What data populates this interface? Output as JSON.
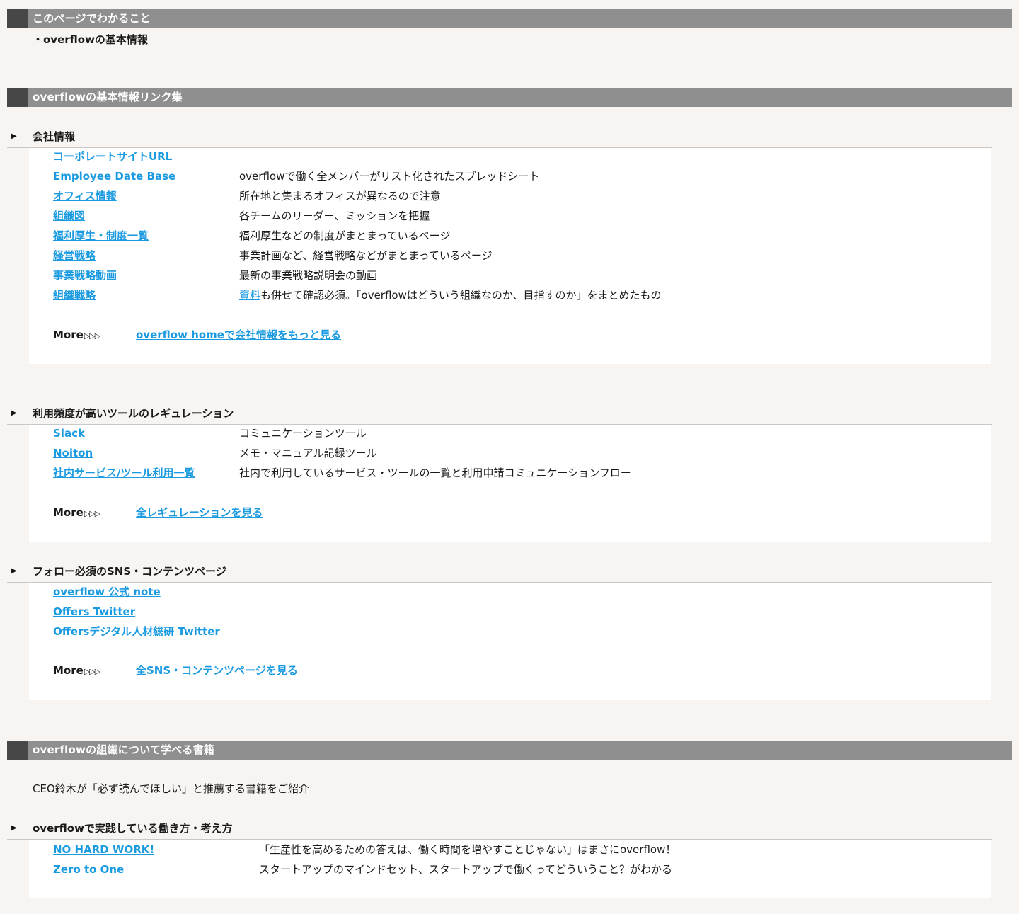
{
  "overview": {
    "header": "このページでわかること",
    "bullet": "・overflowの基本情報"
  },
  "links_section": {
    "header": "overflowの基本情報リンク集",
    "more_label": "More",
    "more_arrows": "▷▷▷",
    "company": {
      "heading": "会社情報",
      "rows": [
        {
          "link": "コーポレートサイトURL",
          "desc": ""
        },
        {
          "link": "Employee Date Base",
          "desc": "overflowで働く全メンバーがリスト化されたスプレッドシート"
        },
        {
          "link": "オフィス情報",
          "desc": "所在地と集まるオフィスが異なるので注意"
        },
        {
          "link": "組織図",
          "desc": "各チームのリーダー、ミッションを把握"
        },
        {
          "link": "福利厚生・制度一覧",
          "desc": "福利厚生などの制度がまとまっているページ"
        },
        {
          "link": "経営戦略",
          "desc": "事業計画など、経営戦略などがまとまっているページ"
        },
        {
          "link": "事業戦略動画",
          "desc": "最新の事業戦略説明会の動画"
        },
        {
          "link": "組織戦略",
          "desc_link": "資料",
          "desc": "も併せて確認必須。「overflowはどういう組織なのか、目指すのか」をまとめたもの"
        }
      ],
      "more_link": "overflow homeで会社情報をもっと見る"
    },
    "tools": {
      "heading": "利用頻度が高いツールのレギュレーション",
      "rows": [
        {
          "link": "Slack",
          "desc": "コミュニケーションツール"
        },
        {
          "link": "Noiton",
          "desc": "メモ・マニュアル記録ツール"
        },
        {
          "link": "社内サービス/ツール利用一覧",
          "desc": "社内で利用しているサービス・ツールの一覧と利用申請コミュニケーションフロー"
        }
      ],
      "more_link": "全レギュレーションを見る"
    },
    "sns": {
      "heading": "フォロー必須のSNS・コンテンツページ",
      "rows": [
        {
          "link": "overflow 公式 note"
        },
        {
          "link": "Offers Twitter"
        },
        {
          "link": "Offersデジタル人材総研 Twitter"
        }
      ],
      "more_link": "全SNS・コンテンツページを見る"
    }
  },
  "books_section": {
    "header": "overflowの組織について学べる書籍",
    "intro": "CEO鈴木が「必ず読んでほしい」と推薦する書籍をご紹介",
    "practice": {
      "heading": "overflowで実践している働き方・考え方",
      "rows": [
        {
          "link": "NO HARD WORK!",
          "desc": "「生産性を高めるための答えは、働く時間を増やすことじゃない」はまさにoverflow！"
        },
        {
          "link": "Zero to One",
          "desc": "スタートアップのマインドセット、スタートアップで働くってどういうこと？がわかる"
        }
      ]
    }
  }
}
